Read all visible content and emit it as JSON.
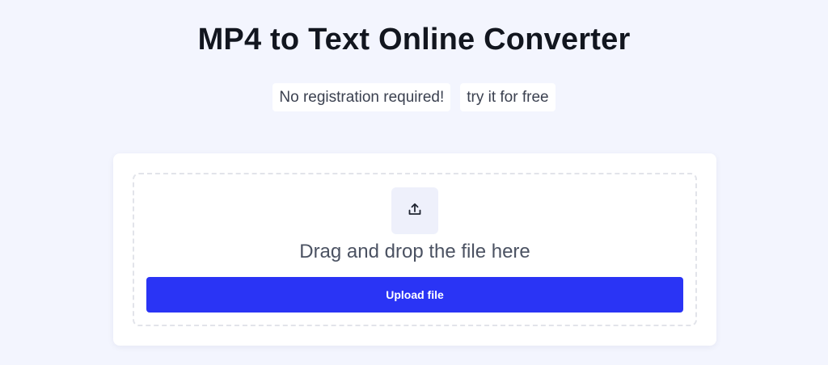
{
  "header": {
    "title": "MP4 to Text Online Converter"
  },
  "tags": [
    {
      "label": "No registration required!"
    },
    {
      "label": "try it for free"
    }
  ],
  "uploader": {
    "icon": "upload-icon",
    "drop_text": "Drag and drop the file here",
    "button_label": "Upload file",
    "accent_color": "#2a34f5"
  }
}
